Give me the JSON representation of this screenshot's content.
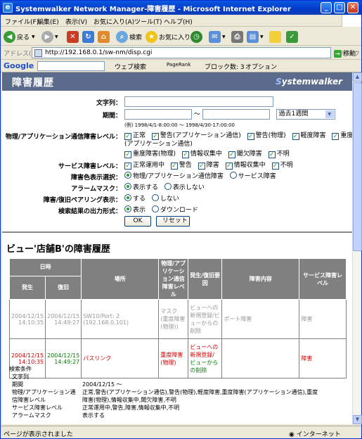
{
  "window": {
    "title": "Systemwalker Network Manager-障害履歴 - Microsoft Internet Explorer",
    "min": "_",
    "max": "□",
    "close": "✕"
  },
  "menu": [
    "ファイル(F)",
    "編集(E)",
    "表示(V)",
    "お気に入り(A)",
    "ツール(T)",
    "ヘルプ(H)"
  ],
  "toolbar": {
    "back": "戻る",
    "search": "検索",
    "favorites": "お気に入り"
  },
  "address": {
    "label": "アドレス(D)",
    "url": "http://192.168.0.1/sw-nm/disp.cgi",
    "go": "移動",
    "links": "リンク"
  },
  "googlebar": {
    "logo": "Google",
    "web_search": "ウェブ検索",
    "pagerank": "PageRank",
    "blocked": "ブロック数: 3",
    "options": "オプション"
  },
  "header": {
    "title": "障害履歴",
    "brand_prefix": "S",
    "brand_rest": "ystemwalker"
  },
  "form": {
    "text_label": "文字列：",
    "period_label": "期間：",
    "period_tilde": "〜",
    "period_select": "過去1週間",
    "period_hint": "(例) 1998/4/1-8:00:00 〜 1998/4/30-17:00:00",
    "level_label": "物理/アプリケーション通信障害レベル：",
    "level_opts_row1": [
      "正常",
      "警告(アプリケーション通信)",
      "警告(物理)",
      "軽度障害",
      "重度障害"
    ],
    "level_opts_row1b": "(アプリケーション通信)",
    "level_opts_row2": [
      "重度障害(物理)",
      "情報収集中",
      "閾欠障害",
      "不明"
    ],
    "service_label": "サービス障害レベル：",
    "service_opts": [
      "正常運用中",
      "警告",
      "障害",
      "情報収集中",
      "不明"
    ],
    "color_label": "障害色表示選択：",
    "color_opts": [
      "物理/アプリケーション通信障害",
      "サービス障害"
    ],
    "alarm_label": "アラームマスク：",
    "alarm_opts": [
      "表示する",
      "表示しない"
    ],
    "pair_label": "障害/復旧ペアリング表示：",
    "pair_opts": [
      "する",
      "しない"
    ],
    "output_label": "検索結果の出力形式：",
    "output_opts": [
      "表示",
      "ダウンロード"
    ],
    "ok": "OK",
    "reset": "リセット"
  },
  "result": {
    "title": "ビュー'店舗B'の障害履歴",
    "headers": {
      "datetime": "日時",
      "occur": "発生",
      "recover": "復旧",
      "place": "場所",
      "level": "物理/アプリケーション通信障害レベル",
      "cause": "発生/復旧要因",
      "content": "障害内容",
      "service": "サービス障害レベル"
    },
    "rows": [
      {
        "occur": "2004/12/15 14:10:35",
        "recover": "2004/12/15 14:49:27",
        "place": "SW10/Port: 2 (192.168.0.101)",
        "level": "マスク (重度障害 (物理))",
        "cause": "ビューへの新規登録/ビューからの削除",
        "content": "ポート障害",
        "service": "障害"
      },
      {
        "occur": "2004/12/15 14:10:35",
        "recover": "2004/12/15 14:49:27",
        "place": "パスリンク",
        "level": "重度障害 (物理)",
        "cause_a": "ビューへの新規登録/",
        "cause_b": "ビューからの削除",
        "content": "",
        "service": "障害"
      }
    ]
  },
  "conditions": {
    "title": "検索条件",
    "items": [
      {
        "k": "文字列",
        "v": ""
      },
      {
        "k": "期間",
        "v": "2004/12/15 〜"
      },
      {
        "k": "物理/アプリケーション通",
        "v": "正常,警告(アプリケーション通信),警告(物理),軽度障害,重度障害(アプリケーション通信),重度"
      },
      {
        "k": "信障害レベル",
        "v": "障害(物理),情報収集中,閾欠障害,不明"
      },
      {
        "k": "サービス障害レベル",
        "v": "正常運用中,警告,障害,情報収集中,不明"
      },
      {
        "k": "アラームマスク",
        "v": "表示する"
      }
    ]
  },
  "status": {
    "text": "ページが表示されました",
    "zone": "インターネット"
  }
}
